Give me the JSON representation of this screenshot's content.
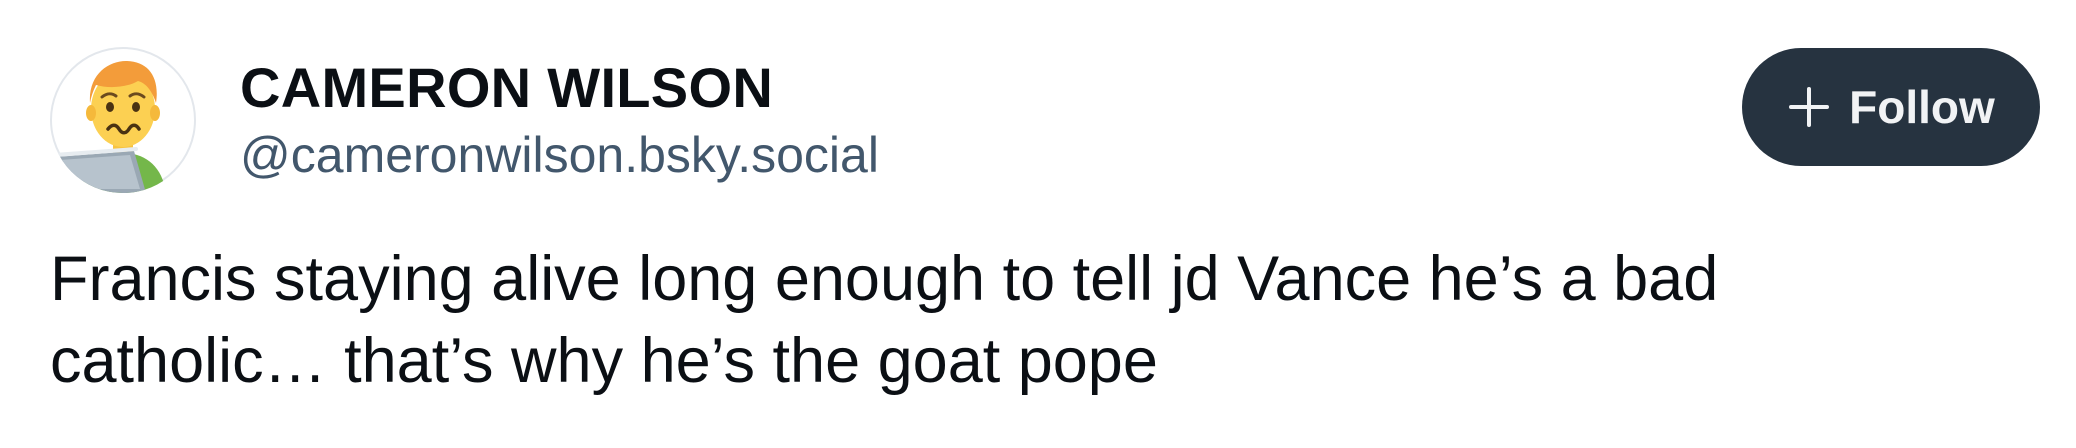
{
  "author": {
    "display_name": "CAMERON WILSON",
    "handle": "@cameronwilson.bsky.social",
    "avatar_icon": "person-with-laptop-emoji-avatar"
  },
  "actions": {
    "follow_label": "Follow",
    "follow_icon": "plus-icon"
  },
  "post": {
    "text": "Francis staying alive long enough to tell jd Vance he’s a bad catholic… that’s why he’s the goat pope"
  },
  "colors": {
    "follow_button_bg": "#263340",
    "handle_text": "#42576c",
    "body_text": "#0b0f14"
  }
}
